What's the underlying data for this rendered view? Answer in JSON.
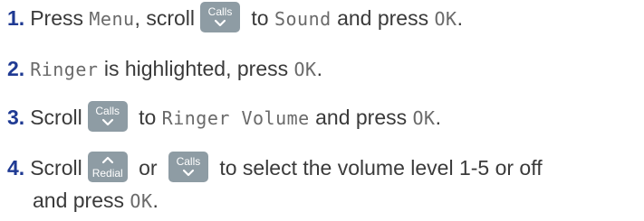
{
  "steps": [
    {
      "num": "1.",
      "t1": "Press ",
      "lcd1": "Menu",
      "t2": ", scroll",
      "key": "Calls",
      "t3": " to ",
      "lcd2": "Sound",
      "t4": " and press ",
      "lcd3": "OK",
      "t5": "."
    },
    {
      "num": "2.",
      "lcd1": "Ringer",
      "t1": " is highlighted, press ",
      "lcd2": "OK",
      "t2": "."
    },
    {
      "num": "3.",
      "t1": "Scroll",
      "key": "Calls",
      "t2": " to ",
      "lcd1": "Ringer Volume",
      "t3": " and press ",
      "lcd2": "OK",
      "t4": "."
    },
    {
      "num": "4.",
      "t1": "Scroll",
      "key1": "Redial",
      "t2": " or ",
      "key2": "Calls",
      "t3": " to select the volume level 1-5 or off",
      "t4": "and press ",
      "lcd1": "OK",
      "t5": "."
    }
  ],
  "icons": {
    "down_arrow": "chevron-down-icon",
    "up_arrow": "chevron-up-icon"
  },
  "colors": {
    "step_number": "#1f3a93",
    "key_background": "#8e9ca4",
    "text": "#3a3a3a"
  }
}
